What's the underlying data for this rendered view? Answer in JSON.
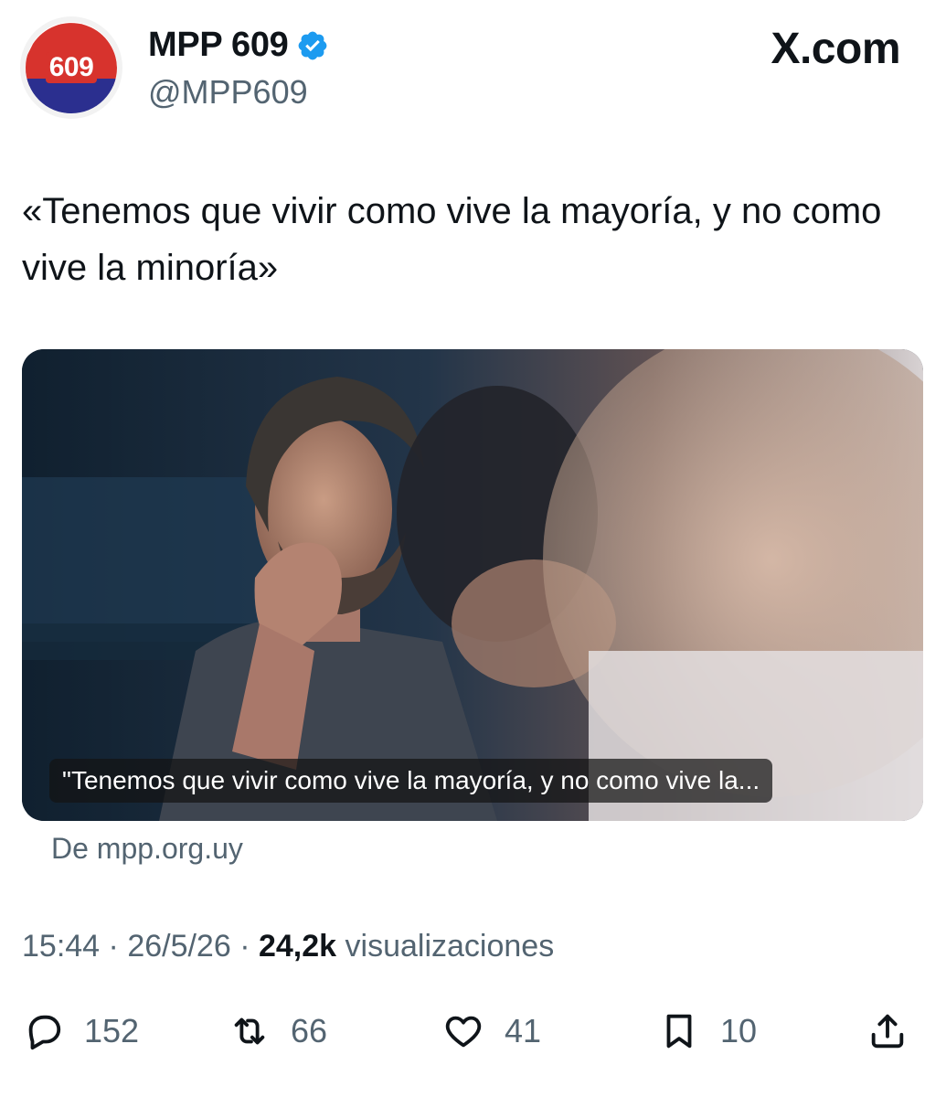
{
  "header": {
    "avatar_text": "609",
    "display_name": "MPP 609",
    "handle": "@MPP609",
    "brand": "X.com"
  },
  "tweet": {
    "text": "«Tenemos que vivir como vive la mayoría, y no como vive la minoría»"
  },
  "card": {
    "caption": "\"Tenemos que vivir como vive la mayoría, y no como vive la...",
    "source": "De mpp.org.uy"
  },
  "meta": {
    "time": "15:44",
    "sep1": " · ",
    "date": "26/5/26",
    "sep2": " · ",
    "views": "24,2k",
    "views_label": " visualizaciones"
  },
  "actions": {
    "replies": "152",
    "reposts": "66",
    "likes": "41",
    "bookmarks": "10"
  },
  "icons": {
    "reply": "reply-icon",
    "repost": "repost-icon",
    "like": "heart-icon",
    "bookmark": "bookmark-icon",
    "share": "share-icon",
    "verified": "verified-badge-icon"
  },
  "colors": {
    "verified": "#1d9bf0",
    "text": "#0f1419",
    "muted": "#536471",
    "avatar_red": "#d7332d",
    "avatar_blue": "#2b2f8f"
  }
}
